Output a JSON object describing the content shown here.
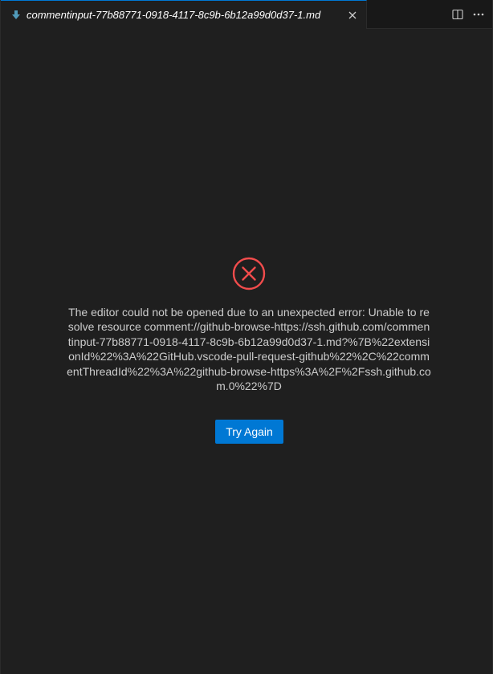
{
  "tab": {
    "title": "commentinput-77b88771-0918-4117-8c9b-6b12a99d0d37-1.md",
    "icon": "markdown-arrow-icon",
    "icon_color": "#519aba"
  },
  "editor_actions": {
    "split_icon": "split-editor-icon",
    "more_icon": "more-actions-icon"
  },
  "error": {
    "icon": "error-circle-icon",
    "icon_color": "#f14c4c",
    "message": "The editor could not be opened due to an unexpected error: Unable to resolve resource comment://github-browse-https://ssh.github.com/commentinput-77b88771-0918-4117-8c9b-6b12a99d0d37-1.md?%7B%22extensionId%22%3A%22GitHub.vscode-pull-request-github%22%2C%22commentThreadId%22%3A%22github-browse-https%3A%2F%2Fssh.github.com.0%22%7D",
    "button_label": "Try Again"
  },
  "colors": {
    "background": "#1f1f1f",
    "tabbar": "#181818",
    "accent": "#0078d4"
  }
}
